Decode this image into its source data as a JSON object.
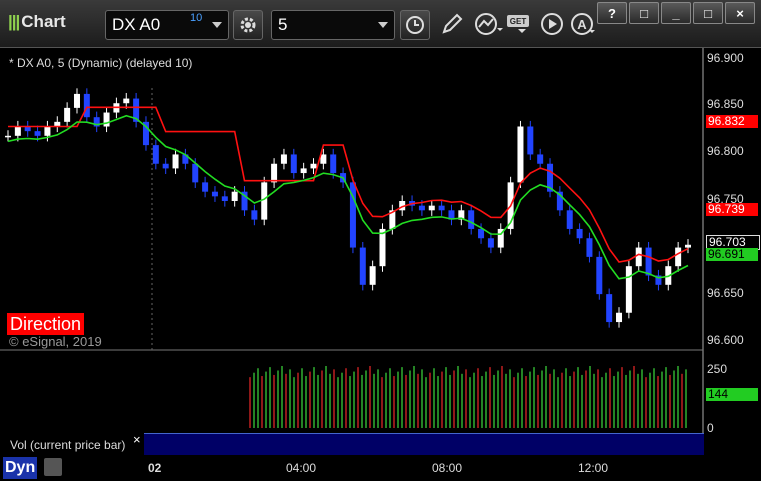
{
  "app": {
    "title": "Chart"
  },
  "toolbar": {
    "symbol": "DX A0",
    "symbol_sup": "10",
    "interval": "5",
    "icons": [
      "settings-gear-icon",
      "clock-icon",
      "pencil-icon",
      "study-icon",
      "get-icon",
      "play-icon",
      "alert-icon"
    ]
  },
  "window_buttons": [
    "?",
    "□",
    "_",
    "□",
    "×"
  ],
  "chart": {
    "study_title": "* DX A0, 5 (Dynamic) (delayed 10)",
    "direction_label": "Direction",
    "copyright": "© eSignal, 2019",
    "price_axis": [
      "96.900",
      "96.850",
      "96.800",
      "96.750",
      "96.700",
      "96.650",
      "96.600"
    ],
    "price_tags": {
      "upper": "96.832",
      "mid": "96.739",
      "last": "96.703",
      "green": "96.691"
    },
    "colors": {
      "up": "#ffffff",
      "down": "#2244ff",
      "red_line": "#ff1111",
      "green_line": "#22dd22",
      "tag_red": "#ff0000",
      "tag_green": "#22cc22"
    }
  },
  "volume": {
    "label": "Vol (current price bar)",
    "close": "×",
    "axis": [
      "250",
      "0"
    ],
    "value_tag": "144"
  },
  "bottom": {
    "dyn": "Dyn",
    "time_labels": [
      "02",
      "04:00",
      "08:00",
      "12:00"
    ]
  },
  "chart_data": {
    "type": "candlestick",
    "title": "* DX A0, 5 (Dynamic) (delayed 10)",
    "ylim": [
      96.59,
      96.91
    ],
    "x_ticks": [
      "02",
      "04:00",
      "08:00",
      "12:00"
    ],
    "y_ticks": [
      96.9,
      96.85,
      96.8,
      96.75,
      96.7,
      96.65,
      96.6
    ],
    "series": [
      {
        "name": "close",
        "values": [
          96.82,
          96.83,
          96.825,
          96.82,
          96.83,
          96.835,
          96.85,
          96.865,
          96.84,
          96.83,
          96.845,
          96.855,
          96.86,
          96.835,
          96.81,
          96.79,
          96.785,
          96.8,
          96.79,
          96.77,
          96.76,
          96.755,
          96.75,
          96.76,
          96.74,
          96.73,
          96.77,
          96.79,
          96.8,
          96.78,
          96.785,
          96.79,
          96.8,
          96.78,
          96.77,
          96.7,
          96.66,
          96.68,
          96.72,
          96.74,
          96.75,
          96.745,
          96.74,
          96.745,
          96.74,
          96.73,
          96.74,
          96.72,
          96.71,
          96.7,
          96.72,
          96.77,
          96.83,
          96.8,
          96.79,
          96.76,
          96.74,
          96.72,
          96.71,
          96.69,
          96.65,
          96.62,
          96.63,
          96.68,
          96.7,
          96.67,
          96.66,
          96.68,
          96.7,
          96.703
        ]
      }
    ]
  }
}
